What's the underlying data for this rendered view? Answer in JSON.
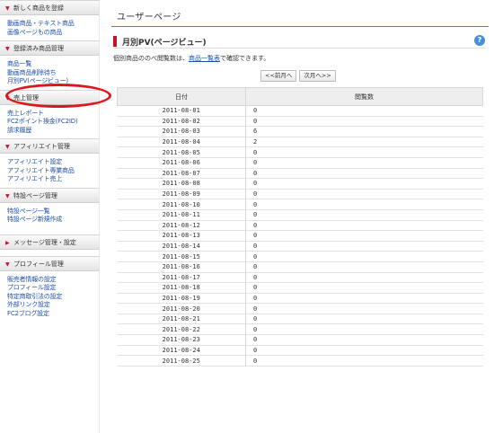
{
  "sidebar": {
    "sections": [
      {
        "title": "新しく商品を登録",
        "items": [
          "動画商品・テキスト商品",
          "画像ページもの商品"
        ]
      },
      {
        "title": "登録済み商品管理",
        "items": [
          "商品一覧",
          "動画商品削除待ち",
          "月別PV(ページビュー)"
        ]
      },
      {
        "title": "売上管理",
        "items": [
          "売上レポート",
          "FC2ポイント換金(FC2ID)",
          "請求履歴"
        ]
      },
      {
        "title": "アフィリエイト管理",
        "items": [
          "アフィリエイト設定",
          "アフィリエイト専業商品",
          "アフィリエイト売上"
        ]
      },
      {
        "title": "特設ページ管理",
        "items": [
          "特設ページ一覧",
          "特設ページ新規作成"
        ]
      },
      {
        "title": "メッセージ管理・設定",
        "items": []
      },
      {
        "title": "プロフィール管理",
        "items": [
          "販売者情報の設定",
          "プロフィール設定",
          "特定商取引法の設定",
          "外部リンク設定",
          "FC2ブログ設定"
        ]
      }
    ]
  },
  "main": {
    "page_title": "ユーザーページ",
    "section_title": "月別PV(ページビュー)",
    "help_label": "?",
    "description_before": "個別商品ののべ閲覧数は、",
    "description_link": "商品一覧表",
    "description_after": "で確認できます。",
    "pager": {
      "prev": "<<前月へ",
      "next": "次月へ>>"
    },
    "table": {
      "headers": [
        "日付",
        "閲覧数"
      ],
      "rows": [
        {
          "date": "2011-08-01",
          "count": "0"
        },
        {
          "date": "2011-08-02",
          "count": "0"
        },
        {
          "date": "2011-08-03",
          "count": "6"
        },
        {
          "date": "2011-08-04",
          "count": "2"
        },
        {
          "date": "2011-08-05",
          "count": "0"
        },
        {
          "date": "2011-08-06",
          "count": "0"
        },
        {
          "date": "2011-08-07",
          "count": "0"
        },
        {
          "date": "2011-08-08",
          "count": "0"
        },
        {
          "date": "2011-08-09",
          "count": "0"
        },
        {
          "date": "2011-08-10",
          "count": "0"
        },
        {
          "date": "2011-08-11",
          "count": "0"
        },
        {
          "date": "2011-08-12",
          "count": "0"
        },
        {
          "date": "2011-08-13",
          "count": "0"
        },
        {
          "date": "2011-08-14",
          "count": "0"
        },
        {
          "date": "2011-08-15",
          "count": "0"
        },
        {
          "date": "2011-08-16",
          "count": "0"
        },
        {
          "date": "2011-08-17",
          "count": "0"
        },
        {
          "date": "2011-08-18",
          "count": "0"
        },
        {
          "date": "2011-08-19",
          "count": "0"
        },
        {
          "date": "2011-08-20",
          "count": "0"
        },
        {
          "date": "2011-08-21",
          "count": "0"
        },
        {
          "date": "2011-08-22",
          "count": "0"
        },
        {
          "date": "2011-08-23",
          "count": "0"
        },
        {
          "date": "2011-08-24",
          "count": "0"
        },
        {
          "date": "2011-08-25",
          "count": "0"
        }
      ]
    }
  },
  "colors": {
    "accent": "#c8102e",
    "link": "#1f4fa8",
    "annotation": "#e0151b",
    "help": "#4a90d9"
  }
}
